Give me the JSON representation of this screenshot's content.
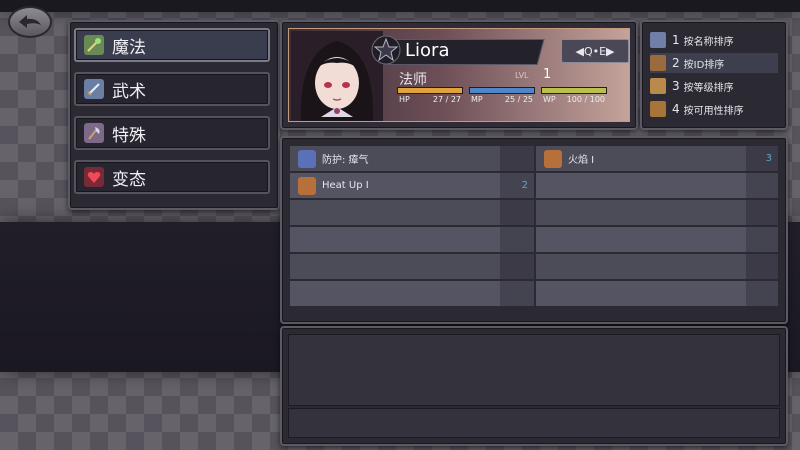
{
  "categories": [
    {
      "label": "魔法",
      "icon": "wand-icon",
      "active": true
    },
    {
      "label": "武术",
      "icon": "sword-icon",
      "active": false
    },
    {
      "label": "特殊",
      "icon": "axe-icon",
      "active": false
    },
    {
      "label": "变态",
      "icon": "heart-icon",
      "active": false
    }
  ],
  "character": {
    "name": "Liora",
    "qe_label": "◀Q•E▶",
    "class_label": "法师",
    "level_label": "LVL",
    "level": "1",
    "stats": [
      {
        "label": "HP",
        "value": "27 / 27",
        "fraction": 1.0,
        "color": "#e0a33a"
      },
      {
        "label": "MP",
        "value": "25 / 25",
        "fraction": 1.0,
        "color": "#4d86c9"
      },
      {
        "label": "WP",
        "value": "100 / 100",
        "fraction": 1.0,
        "color": "#b8c24a"
      }
    ]
  },
  "sort_options": [
    {
      "num": "1",
      "label": "按名称排序",
      "icon": "quill-icon",
      "active": false
    },
    {
      "num": "2",
      "label": "按ID排序",
      "icon": "book-icon",
      "active": true
    },
    {
      "num": "3",
      "label": "按等级排序",
      "icon": "scroll-icon",
      "active": false
    },
    {
      "num": "4",
      "label": "按可用性排序",
      "icon": "pouch-icon",
      "active": false
    }
  ],
  "skills_left": [
    {
      "name": "防护: 瘴气",
      "cost": "",
      "icon": "shield-magic-icon"
    },
    {
      "name": "Heat Up I",
      "cost": "2",
      "icon": "fire-magic-icon"
    }
  ],
  "skills_right": [
    {
      "name": "火焰 I",
      "cost": "3",
      "icon": "fire-magic-icon"
    }
  ],
  "colors": {
    "accent_blue": "#5aa7c8",
    "card_border": "#c79a7c"
  }
}
